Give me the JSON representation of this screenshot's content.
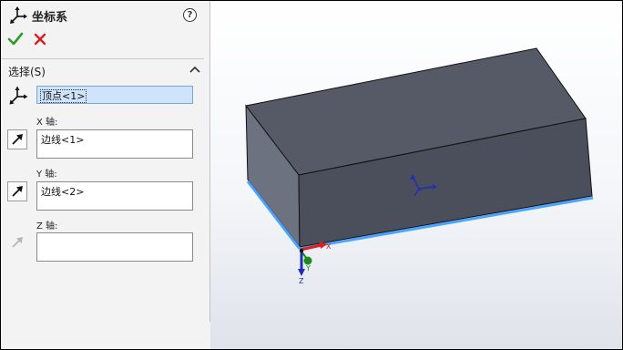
{
  "panel": {
    "title": "坐标系",
    "help_label": "?",
    "section_title": "选择(S)",
    "origin": {
      "value": "顶点<1>"
    },
    "x_axis": {
      "label": "X 轴:",
      "value": "边线<1>"
    },
    "y_axis": {
      "label": "Y 轴:",
      "value": "边线<2>"
    },
    "z_axis": {
      "label": "Z 轴:",
      "value": ""
    }
  },
  "triad": {
    "x_label": "X",
    "y_label": "Y",
    "z_label": "Z"
  },
  "icons": {
    "feature": "coordinate-system-icon",
    "ok": "checkmark-icon",
    "cancel": "x-icon",
    "help": "help-icon",
    "collapse": "chevron-up-icon",
    "direction": "direction-arrow-icon"
  },
  "colors": {
    "ok": "#2e9b2e",
    "cancel": "#d62020",
    "selection_highlight": "#cfe3fb",
    "edge_highlight": "#4aa3ff",
    "box_top": "#565a66",
    "box_front": "#4b4f5b",
    "box_side": "#6d7280",
    "axis_x": "#e02020",
    "axis_y": "#1a8c1a",
    "axis_z": "#1f2fb4"
  }
}
